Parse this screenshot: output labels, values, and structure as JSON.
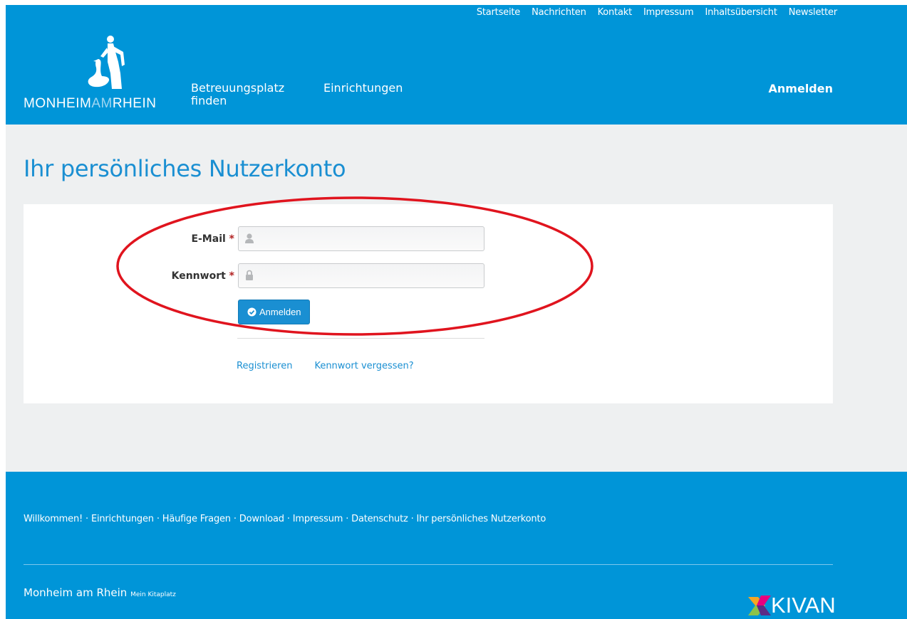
{
  "header": {
    "top_nav": [
      "Startseite",
      "Nachrichten",
      "Kontakt",
      "Impressum",
      "Inhaltsübersicht",
      "Newsletter"
    ],
    "logo": {
      "text_main": "MONHEIM",
      "text_am": "AM",
      "text_end": "RHEIN"
    },
    "main_nav": {
      "item1_line1": "Betreuungsplatz",
      "item1_line2": "finden",
      "item2": "Einrichtungen"
    },
    "login_link": "Anmelden"
  },
  "main": {
    "title": "Ihr persönliches Nutzerkonto",
    "form": {
      "email_label": "E-Mail",
      "password_label": "Kennwort",
      "required_mark": "*",
      "email_value": "",
      "password_value": "",
      "submit_label": "Anmelden"
    },
    "links": {
      "register": "Registrieren",
      "forgot": "Kennwort vergessen?"
    }
  },
  "footer": {
    "nav": [
      "Willkommen!",
      "Einrichtungen",
      "Häufige Fragen",
      "Download",
      "Impressum",
      "Datenschutz",
      "Ihr persönliches Nutzerkonto"
    ],
    "separator": "·",
    "brand": "Monheim am Rhein",
    "brand_sub": "Mein Kitaplatz",
    "partner_logo": "KIVAN"
  },
  "colors": {
    "brand_blue": "#0095d8",
    "link_blue": "#1a8fd2",
    "annotation_red": "#e0141e",
    "background": "#eef0f1"
  },
  "icons": {
    "user": "user-icon",
    "lock": "lock-icon",
    "check": "check-circle-icon"
  }
}
